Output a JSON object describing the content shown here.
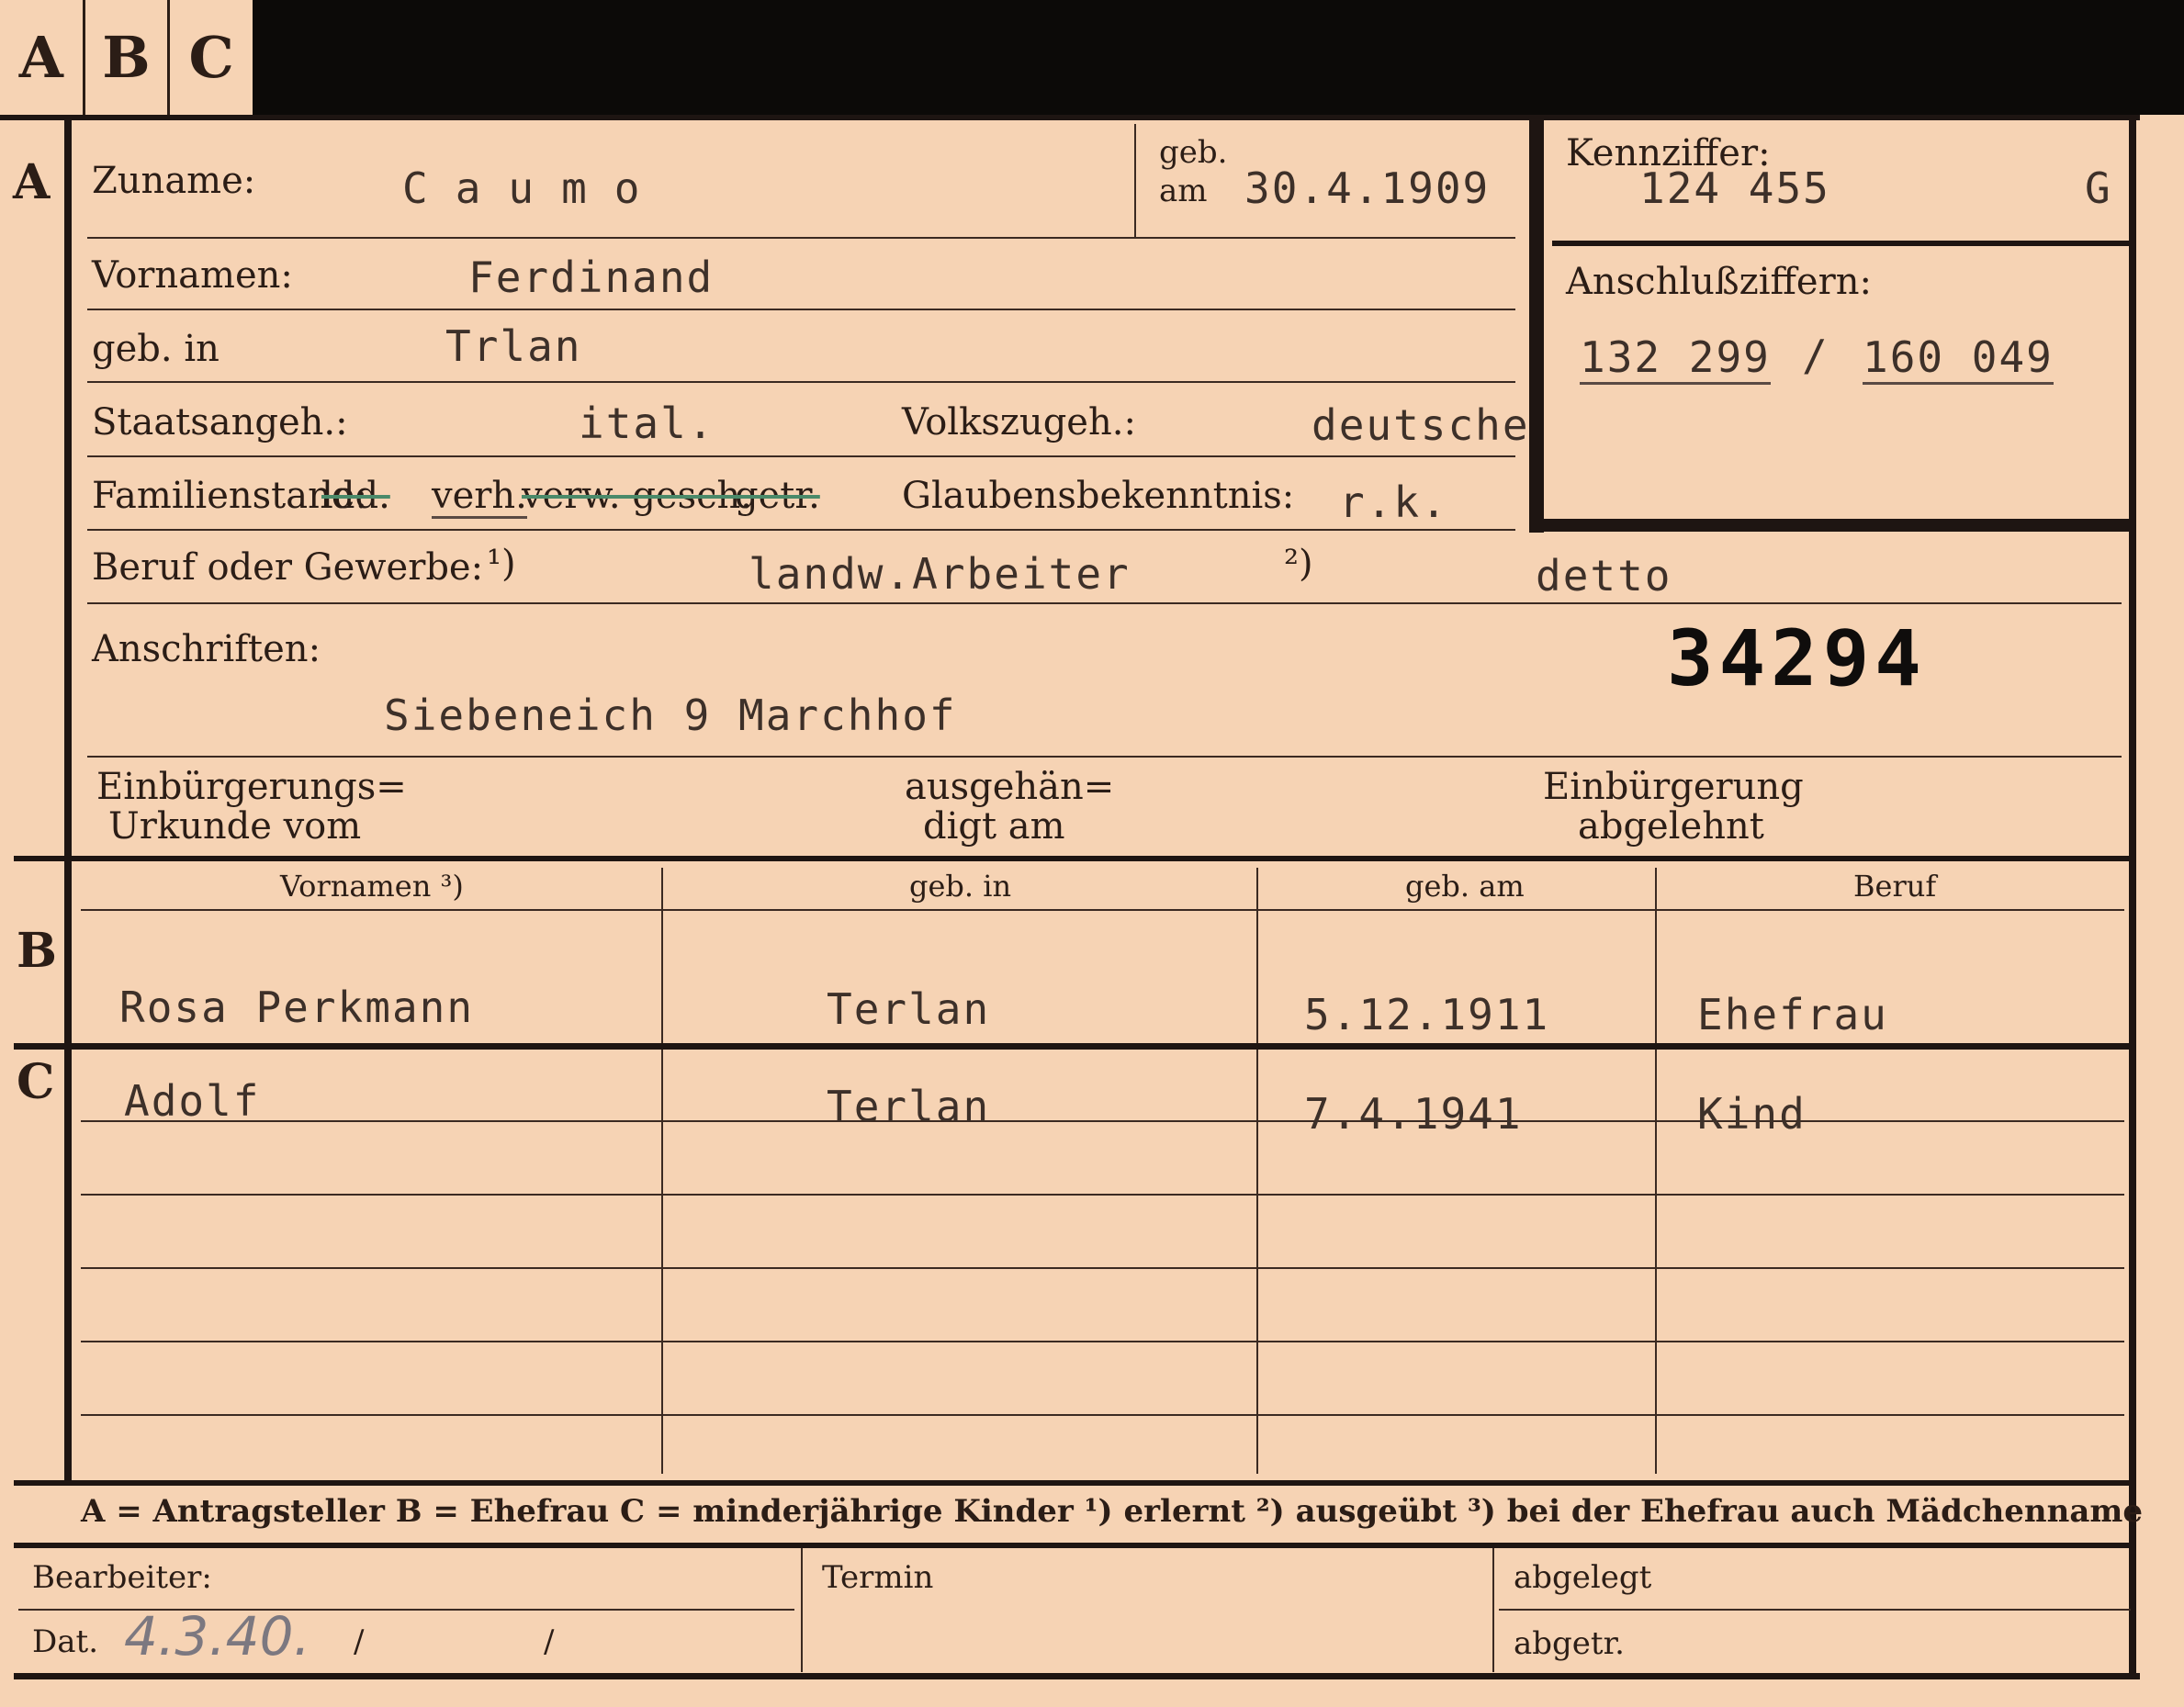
{
  "tabs": [
    "A",
    "B",
    "C"
  ],
  "section_letters": {
    "a": "A",
    "b": "B",
    "c": "C"
  },
  "labels": {
    "zuname": "Zuname:",
    "geb": "geb.",
    "am": "am",
    "vornamen": "Vornamen:",
    "geb_in": "geb. in",
    "staatsangeh": "Staatsangeh.:",
    "volkszugeh": "Volkszugeh.:",
    "familienstand": "Familienstand:",
    "fam_led": "led.",
    "fam_verh": "verh.",
    "fam_verw_gesch": "verw. gesch.",
    "fam_getr": "getr.",
    "glaubensbekenntnis": "Glaubensbekenntnis:",
    "beruf": "Beruf oder Gewerbe:",
    "fn1": "¹)",
    "fn2": "²)",
    "anschriften": "Anschriften:",
    "einb_urkunde_1": "Einbürgerungs=",
    "einb_urkunde_2": "Urkunde vom",
    "ausgehaen_1": "ausgehän=",
    "ausgehaen_2": "digt am",
    "einb_abgelehnt_1": "Einbürgerung",
    "einb_abgelehnt_2": "abgelehnt",
    "kennziffer": "Kennziffer:",
    "anschlussziffern": "Anschlußziffern:",
    "col_vornamen": "Vornamen ³)",
    "col_geb_in": "geb. in",
    "col_geb_am": "geb. am",
    "col_beruf": "Beruf",
    "bearbeiter": "Bearbeiter:",
    "termin": "Termin",
    "abgelegt": "abgelegt",
    "dat": "Dat.",
    "abgetr": "abgetr."
  },
  "legend": "A = Antragsteller   B = Ehefrau   C = minderjährige Kinder   ¹) erlernt   ²) ausgeübt   ³) bei der Ehefrau auch Mädchenname",
  "values": {
    "zuname": "Caumo",
    "geb_am": "30.4.1909",
    "vornamen": "Ferdinand",
    "geb_in": "Trlan",
    "staatsangeh": "ital.",
    "volkszugeh": "deutsche",
    "glaube": "r.k.",
    "beruf_erlernt": "landw.Arbeiter",
    "beruf_ausgeuebt": "detto",
    "anschrift": "Siebeneich 9  Marchhof",
    "stamp_number": "34294",
    "kennziffer": "124 455",
    "kennziffer_suffix": "G",
    "anschluss_1": "132 299",
    "anschluss_sep": "/",
    "anschluss_2": "160 049",
    "dat_value": "4.3.40.",
    "dat_slash1": "/",
    "dat_slash2": "/"
  },
  "spouse": {
    "vornamen": "Rosa Perkmann",
    "geb_in": "Terlan",
    "geb_am": "5.12.1911",
    "beruf": "Ehefrau"
  },
  "children": [
    {
      "vornamen": "Adolf",
      "geb_in": "Terlan",
      "geb_am": "7.4.1941",
      "beruf": "Kind"
    }
  ]
}
